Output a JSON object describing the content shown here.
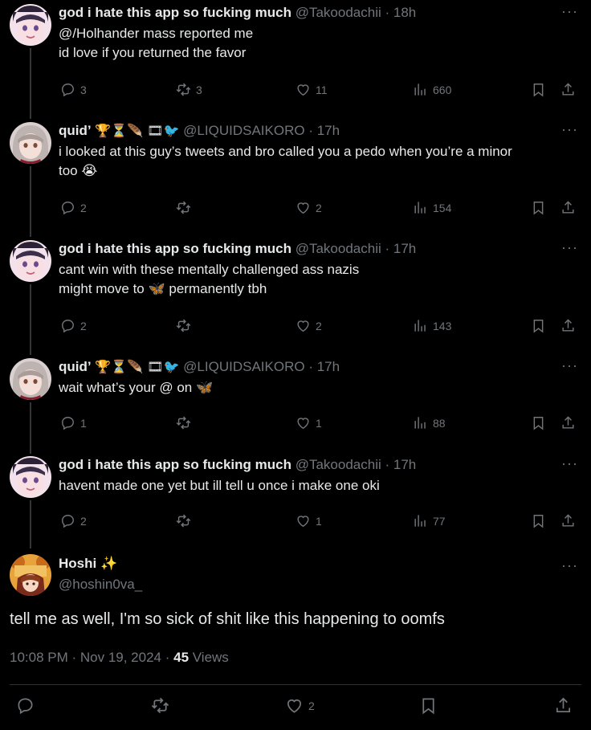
{
  "thread": [
    {
      "name": "god i hate this app so fucking much",
      "name_emojis": "",
      "handle": "@Takoodachii",
      "time": "· 18h",
      "lines": [
        "@/Holhander mass reported me",
        "id love if you returned the favor"
      ],
      "replies": "3",
      "reposts": "3",
      "likes": "11",
      "views": "660",
      "avatar": "pink-hair-girl"
    },
    {
      "name": "quid’",
      "name_emojis": "🏆⏳🪶 🎞🐦",
      "handle": "@LIQUIDSAIKORO",
      "time": "· 17h",
      "lines": [
        "i looked at this guy’s tweets and bro called you a pedo when you’re a minor",
        "too 😭"
      ],
      "replies": "2",
      "reposts": "",
      "likes": "2",
      "views": "154",
      "avatar": "white-hair-girl"
    },
    {
      "name": "god i hate this app so fucking much",
      "name_emojis": "",
      "handle": "@Takoodachii",
      "time": "· 17h",
      "lines": [
        "cant win with these mentally challenged ass nazis",
        "might move to 🦋 permanently tbh"
      ],
      "replies": "2",
      "reposts": "",
      "likes": "2",
      "views": "143",
      "avatar": "pink-hair-girl"
    },
    {
      "name": "quid’",
      "name_emojis": "🏆⏳🪶 🎞🐦",
      "handle": "@LIQUIDSAIKORO",
      "time": "· 17h",
      "lines": [
        "wait what’s your @ on 🦋"
      ],
      "replies": "1",
      "reposts": "",
      "likes": "1",
      "views": "88",
      "avatar": "white-hair-girl"
    },
    {
      "name": "god i hate this app so fucking much",
      "name_emojis": "",
      "handle": "@Takoodachii",
      "time": "· 17h",
      "lines": [
        "havent made one yet but ill tell u once i make one oki"
      ],
      "replies": "2",
      "reposts": "",
      "likes": "1",
      "views": "77",
      "avatar": "pink-hair-girl"
    }
  ],
  "main": {
    "name": "Hoshi",
    "name_emoji": "✨",
    "handle": "@hoshin0va_",
    "text": "tell me as well, I'm so sick of shit like this happening to oomfs",
    "time": "10:08 PM · Nov 19, 2024 · ",
    "views_count": "45",
    "views_label": " Views",
    "likes": "2"
  },
  "more_glyph": "···",
  "colors": {
    "bg": "#000000",
    "text": "#e7e9ea",
    "muted": "#71767b",
    "line": "#333639"
  }
}
